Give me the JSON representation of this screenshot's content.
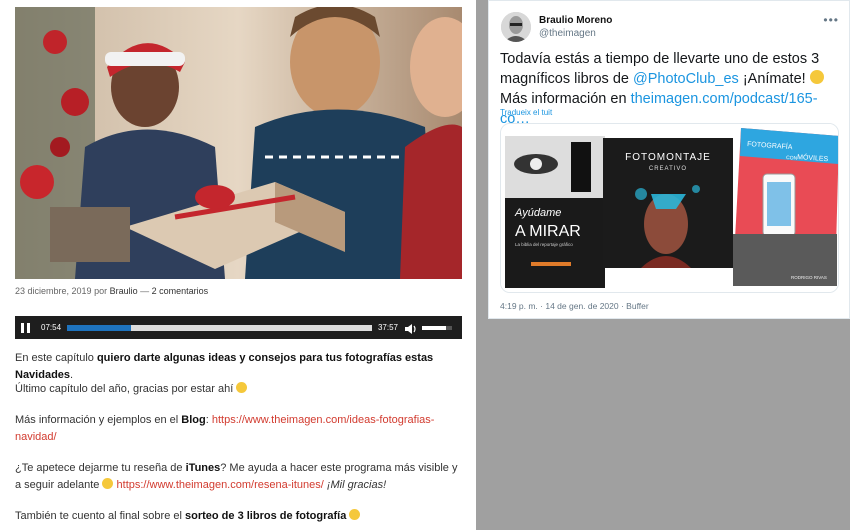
{
  "blog": {
    "byline": {
      "date": "23 diciembre, 2019",
      "by": "por",
      "author": "Braulio",
      "separator": "—",
      "comments": "2 comentarios"
    },
    "player": {
      "current_time": "07:54",
      "duration": "37:57",
      "progress": 0.21,
      "buffered": 1.0,
      "volume": 0.8
    },
    "paragraphs": {
      "p1_a": "En este capítulo ",
      "p1_b": "quiero darte algunas ideas y consejos para tus fotografías estas Navidades",
      "p1_c": ".",
      "p2": "Último capítulo del año, gracias por estar ahí",
      "p3_a": "Más información y ejemplos en el ",
      "p3_b": "Blog",
      "p3_c": ": ",
      "p3_link": "https://www.theimagen.com/ideas-fotografias-navidad/",
      "p4_a": "¿Te apetece dejarme tu reseña de ",
      "p4_b": "iTunes",
      "p4_c": "? Me ayuda a hacer este programa más visible y a seguir adelante ",
      "p4_link": "https://www.theimagen.com/resena-itunes/",
      "p4_d": " ¡Mil gracias!",
      "p5_a": "También te cuento al final sobre el ",
      "p5_b": "sorteo de 3 libros de fotografía"
    }
  },
  "tweet": {
    "name": "Braulio Moreno",
    "handle": "@theimagen",
    "more": "•••",
    "text_a": "Todavía estás a tiempo de llevarte uno de estos 3 magníficos libros de ",
    "mention": "@PhotoClub_es",
    "text_b": " ¡Anímate! ",
    "text_c": " Más información en ",
    "link": "theimagen.com/podcast/165-co…",
    "translate": "Tradueix el tuit",
    "meta": "4:19 p. m. · 14 de gen. de 2020 · Buffer",
    "books": {
      "b1_title": "A MIRAR",
      "b1_script": "Ayúdame",
      "b1_sub": "La biblia del reportaje gráfico",
      "b2_title": "FOTOMONTAJE",
      "b2_sub": "CREATIVO",
      "b3_title": "FOTOGRAFÍA",
      "b3_con": "CON",
      "b3_title2": "MÓVILES",
      "b3_author": "RODRIGO RIVAS"
    }
  },
  "colors": {
    "link_red": "#d23b2f",
    "twitter_blue": "#1b95e0",
    "player_bg": "#1e1e1e",
    "page_gray": "#a0a0a0"
  }
}
